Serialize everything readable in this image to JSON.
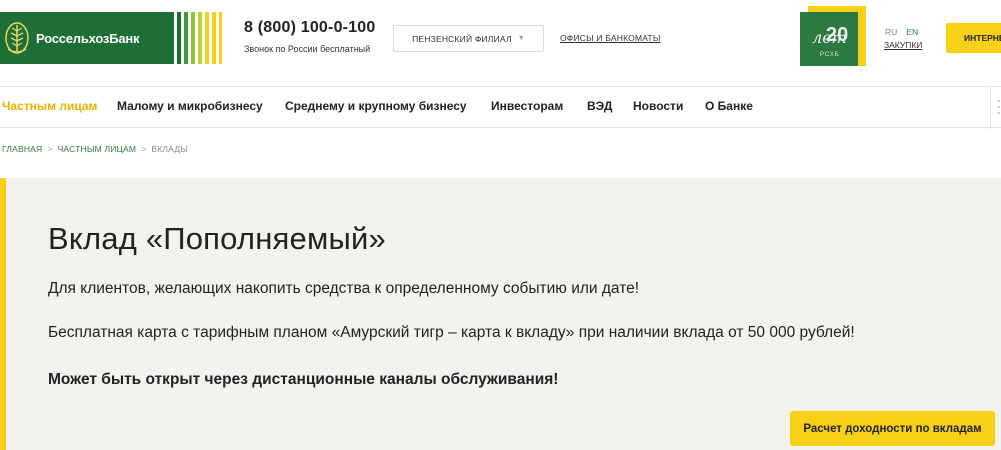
{
  "header": {
    "logo_text": "РоссельхозБанк",
    "phone": "8 (800) 100-0-100",
    "phone_note": "Звонок по России бесплатный",
    "branch_select": "ПЕНЗЕНСКИЙ ФИЛИАЛ",
    "offices_link": "ОФИСЫ И БАНКОМАТЫ",
    "badge": {
      "number": "20",
      "script": "лет",
      "sub": "РСХБ"
    },
    "lang": {
      "ru": "RU",
      "en": "EN"
    },
    "zakupki_link": "ЗАКУПКИ",
    "internet_button": "ИНТЕРНЕТ-БАНК"
  },
  "nav": {
    "items": [
      {
        "label": "Частным лицам",
        "active": true
      },
      {
        "label": "Малому и микробизнесу"
      },
      {
        "label": "Среднему и крупному бизнесу"
      },
      {
        "label": "Инвесторам"
      },
      {
        "label": "ВЭД"
      },
      {
        "label": "Новости"
      },
      {
        "label": "О Банке"
      }
    ]
  },
  "breadcrumbs": {
    "items": [
      "ГЛАВНАЯ",
      "ЧАСТНЫМ ЛИЦАМ"
    ],
    "current": "ВКЛАДЫ",
    "separator": ">"
  },
  "hero": {
    "title": "Вклад «Пополняемый»",
    "p1": "Для клиентов, желающих накопить средства к определенному событию или дате!",
    "p2": "Бесплатная карта с тарифным планом «Амурский тигр – карта к вкладу» при наличии вклада от 50 000 рублей!",
    "p3": "Может быть открыт через дистанционные каналы обслуживания!",
    "calc_button": "Расчет доходности по вкладам"
  },
  "colors": {
    "brand_green": "#1e6f35",
    "accent_yellow": "#f7d117",
    "hero_bg": "#f4f2ed"
  }
}
